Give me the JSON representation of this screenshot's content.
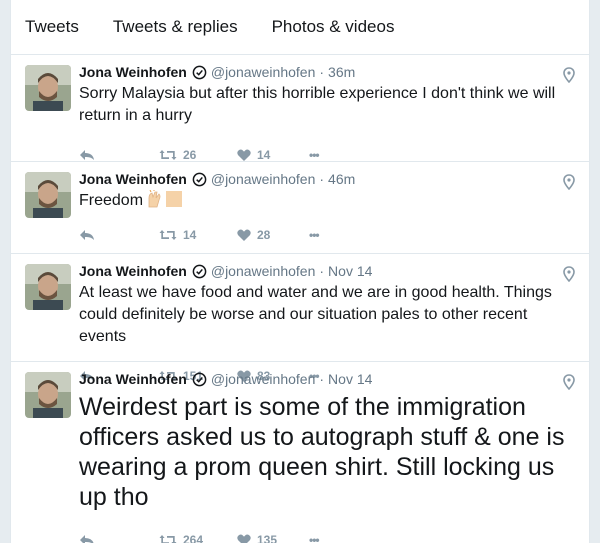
{
  "tabs": [
    "Tweets",
    "Tweets & replies",
    "Photos & videos"
  ],
  "tweets": [
    {
      "name": "Jona Weinhofen",
      "handle": "@jonaweinhofen",
      "dot": "·",
      "time": "36m",
      "text": "Sorry Malaysia but after this horrible experience I don't think we will return in a hurry",
      "retweets": "26",
      "likes": "14",
      "more": "•••"
    },
    {
      "name": "Jona Weinhofen",
      "handle": "@jonaweinhofen",
      "dot": "·",
      "time": "46m",
      "text": "Freedom",
      "retweets": "14",
      "likes": "28",
      "more": "•••"
    },
    {
      "name": "Jona Weinhofen",
      "handle": "@jonaweinhofen",
      "dot": "·",
      "time": "Nov 14",
      "text": "At least we have food and water and we are in good health. Things could definitely be worse and our situation pales to other recent events",
      "retweets": "151",
      "likes": "83",
      "more": "•••"
    },
    {
      "name": "Jona Weinhofen",
      "handle": "@jonaweinhofen",
      "dot": "·",
      "time": "Nov 14",
      "text": "Weirdest part is some of the immigration officers asked us to autograph stuff & one is wearing a prom queen shirt. Still locking us up tho",
      "retweets": "264",
      "likes": "135",
      "more": "•••"
    }
  ],
  "colors": {
    "text": "#14171a",
    "muted": "#657786",
    "icon": "#8899a6",
    "border": "#e1e8ed"
  },
  "icons": [
    "reply-icon",
    "retweet-icon",
    "heart-icon",
    "more-icon",
    "location-pin-icon",
    "verified-icon",
    "raised-hands-emoji"
  ]
}
